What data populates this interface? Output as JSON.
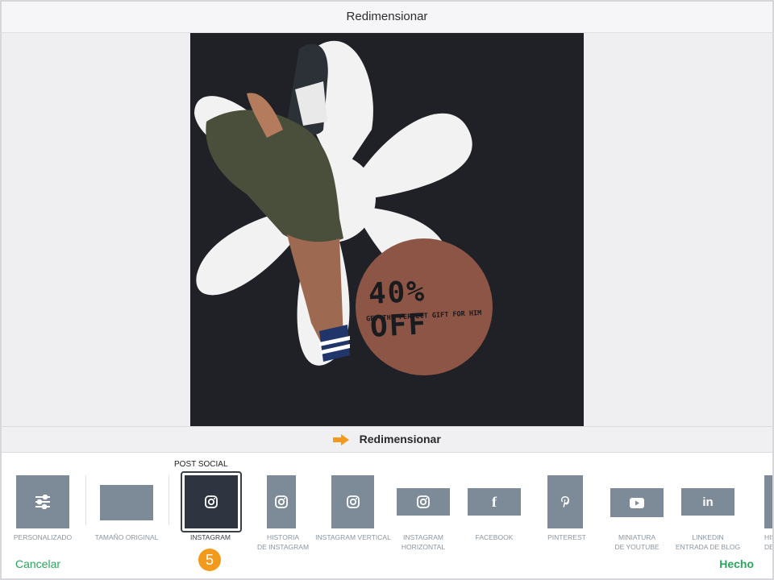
{
  "header": {
    "title": "Redimensionar"
  },
  "artwork": {
    "headline": "40% OFF",
    "subline": "GET THE PERFECT GIFT FOR HIM",
    "colors": {
      "background": "#1f2126",
      "flower": "#f2f2f2",
      "circle": "#8c5545"
    }
  },
  "action_bar": {
    "label": "Redimensionar",
    "arrow_color": "#f39a1c"
  },
  "presets": {
    "group_label": "POST SOCIAL",
    "items": [
      {
        "label": "PERSONALIZADO",
        "icon": "sliders-icon"
      },
      {
        "label": "TAMAÑO ORIGINAL",
        "icon": ""
      },
      {
        "label": "INSTAGRAM",
        "icon": "instagram-icon",
        "selected": true
      },
      {
        "label1": "HISTORIA",
        "label2": "DE INSTAGRAM",
        "icon": "instagram-icon"
      },
      {
        "label": "INSTAGRAM VERTICAL",
        "icon": "instagram-icon"
      },
      {
        "label1": "INSTAGRAM",
        "label2": "HORIZONTAL",
        "icon": "instagram-icon"
      },
      {
        "label": "FACEBOOK",
        "icon": "facebook-icon"
      },
      {
        "label": "PINTEREST",
        "icon": "pinterest-icon"
      },
      {
        "label1": "MINIATURA",
        "label2": "DE YOUTUBE",
        "icon": "youtube-icon"
      },
      {
        "label1": "LINKEDIN",
        "label2": "ENTRADA DE BLOG",
        "icon": "linkedin-icon"
      },
      {
        "label1": "HIS",
        "label2": "DE SN",
        "icon": ""
      }
    ]
  },
  "footer": {
    "cancel_label": "Cancelar",
    "done_label": "Hecho"
  },
  "step_badge": "5",
  "colors": {
    "accent_green": "#2aa55c",
    "tile_gray": "#7c8b97",
    "selected_tile": "#2f3540"
  }
}
